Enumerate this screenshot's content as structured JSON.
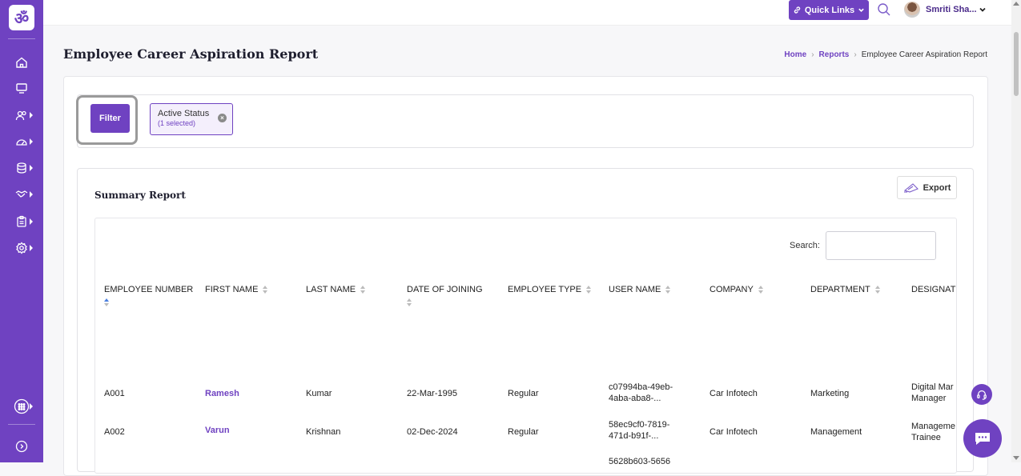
{
  "app": {
    "logo_glyph": "ॐ",
    "accent": "#6f42c1"
  },
  "sidebar": {
    "items": [
      {
        "icon": "home-icon"
      },
      {
        "icon": "monitor-icon"
      },
      {
        "icon": "users-icon"
      },
      {
        "icon": "gauge-icon"
      },
      {
        "icon": "database-icon"
      },
      {
        "icon": "handshake-icon"
      },
      {
        "icon": "clipboard-icon"
      },
      {
        "icon": "settings-icon"
      },
      {
        "icon": "apps-grid-icon"
      },
      {
        "icon": "circle-arrow-icon"
      }
    ]
  },
  "topbar": {
    "quick_links_label": "Quick Links",
    "user_name": "Smriti Sha..."
  },
  "page": {
    "title": "Employee Career Aspiration Report",
    "breadcrumb": {
      "home": "Home",
      "reports": "Reports",
      "current": "Employee Career Aspiration Report"
    }
  },
  "filter": {
    "button_label": "Filter",
    "chip_title": "Active Status",
    "chip_sub": "(1 selected)"
  },
  "summary": {
    "title": "Summary Report",
    "export_label": "Export",
    "search_label": "Search:",
    "search_value": ""
  },
  "table": {
    "columns": [
      "EMPLOYEE NUMBER",
      "FIRST NAME",
      "LAST NAME",
      "DATE OF JOINING",
      "EMPLOYEE TYPE",
      "USER NAME",
      "COMPANY",
      "DEPARTMENT",
      "DESIGNATI"
    ],
    "rows": [
      {
        "emp_no": "A001",
        "first": "Ramesh",
        "last": "Kumar",
        "doj": "22-Mar-1995",
        "type": "Regular",
        "user1": "c07994ba-49eb-",
        "user2": "4aba-aba8-...",
        "company": "Car Infotech",
        "dept": "Marketing",
        "desig1": "Digital Mar",
        "desig2": "Manager"
      },
      {
        "emp_no": "A002",
        "first": "Varun",
        "last": "Krishnan",
        "doj": "02-Dec-2024",
        "type": "Regular",
        "user1": "58ec9cf0-7819-",
        "user2": "471d-b91f-...",
        "company": "Car Infotech",
        "dept": "Management",
        "desig1": "Manageme",
        "desig2": "Trainee"
      },
      {
        "user1": "5628b603-5656"
      }
    ]
  }
}
